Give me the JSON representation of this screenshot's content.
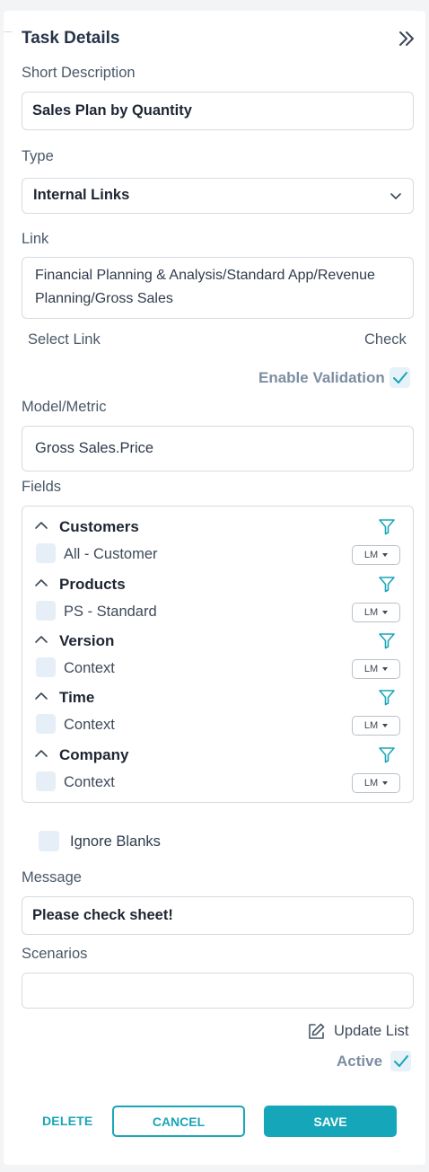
{
  "header": {
    "title": "Task Details"
  },
  "short_description": {
    "label": "Short Description",
    "value": "Sales Plan by Quantity"
  },
  "type": {
    "label": "Type",
    "selected": "Internal Links"
  },
  "link": {
    "label": "Link",
    "value": "Financial Planning & Analysis/Standard App/Revenue Planning/Gross Sales",
    "select_link": "Select Link",
    "check": "Check"
  },
  "validation": {
    "label": "Enable Validation",
    "checked": true
  },
  "model_metric": {
    "label": "Model/Metric",
    "value": "Gross Sales.Price"
  },
  "fields": {
    "label": "Fields",
    "groups": [
      {
        "name": "Customers",
        "item": "All - Customer",
        "mode": "LM"
      },
      {
        "name": "Products",
        "item": "PS - Standard",
        "mode": "LM"
      },
      {
        "name": "Version",
        "item": "Context",
        "mode": "LM"
      },
      {
        "name": "Time",
        "item": "Context",
        "mode": "LM"
      },
      {
        "name": "Company",
        "item": "Context",
        "mode": "LM"
      }
    ]
  },
  "ignore_blanks": {
    "label": "Ignore Blanks",
    "checked": false
  },
  "message": {
    "label": "Message",
    "value": "Please check sheet!"
  },
  "scenarios": {
    "label": "Scenarios",
    "value": ""
  },
  "update_list": {
    "label": "Update List"
  },
  "active": {
    "label": "Active",
    "checked": true
  },
  "actions": {
    "delete": "DELETE",
    "cancel": "CANCEL",
    "save": "SAVE"
  },
  "colors": {
    "accent": "#15a7b9",
    "text": "#2f3b4c",
    "muted_label": "#7d8ea3",
    "check_bg": "#e6eff7"
  },
  "icons": {
    "collapse": "double-chevron-right-icon",
    "dropdown": "chevron-down-icon",
    "check": "check-icon",
    "group_toggle": "chevron-up-icon",
    "filter": "filter-icon",
    "update_list": "edit-icon"
  }
}
